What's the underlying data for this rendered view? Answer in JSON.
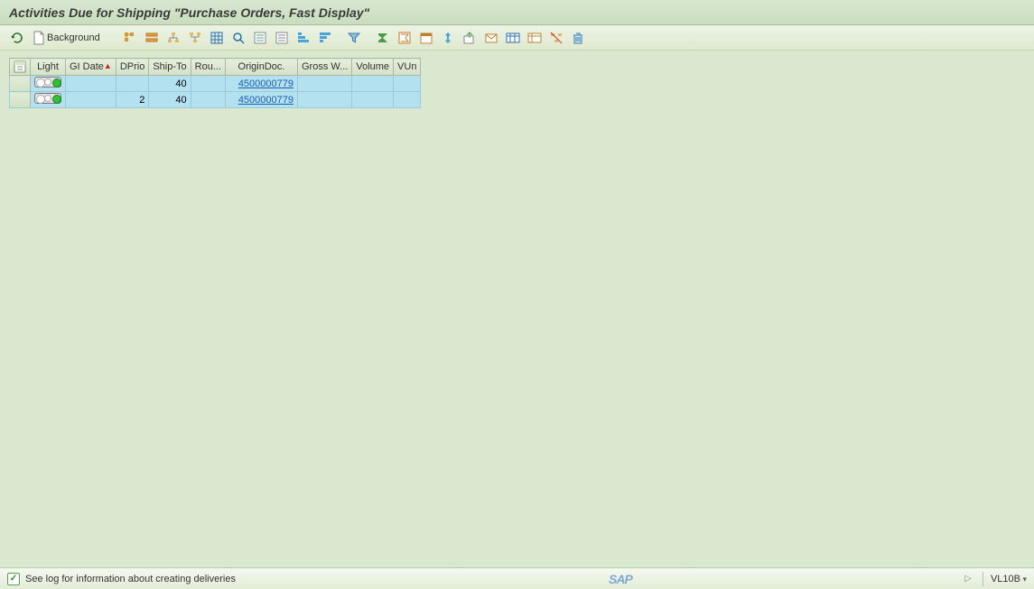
{
  "title": "Activities Due for Shipping \"Purchase Orders, Fast Display\"",
  "toolbar": {
    "refresh_tip": "Refresh",
    "background_label": "Background",
    "icons": {
      "details": "Details",
      "sort_asc": "Sort Ascending",
      "sort_desc": "Sort Descending",
      "find": "Find",
      "table": "Table",
      "filter": "Filter",
      "sum": "Total",
      "subtotal": "Subtotal",
      "print": "Print",
      "export": "Export",
      "layout": "Choose Layout",
      "variant": "Change Layout",
      "save_layout": "Save Layout",
      "mail": "Mail",
      "graphic": "Graphic",
      "select_all": "Select All",
      "deselect_all": "Deselect All",
      "delete": "Delete"
    }
  },
  "columns": [
    "",
    "Light",
    "GI Date",
    "DPrio",
    "Ship-To",
    "Rou...",
    "OriginDoc.",
    "Gross W...",
    "Volume",
    "VUn"
  ],
  "rows": [
    {
      "light": "green",
      "gi_date": "",
      "dprio": "",
      "ship_to": "40",
      "route": "",
      "origin_doc": "4500000779",
      "gross_w": "",
      "volume": "",
      "vun": ""
    },
    {
      "light": "green",
      "gi_date": "",
      "dprio": "2",
      "ship_to": "40",
      "route": "",
      "origin_doc": "4500000779",
      "gross_w": "",
      "volume": "",
      "vun": ""
    }
  ],
  "color_accent": "#b3e1ef",
  "status": {
    "message": "See log for information about creating deliveries",
    "tcode": "VL10B",
    "logo": "SAP"
  }
}
